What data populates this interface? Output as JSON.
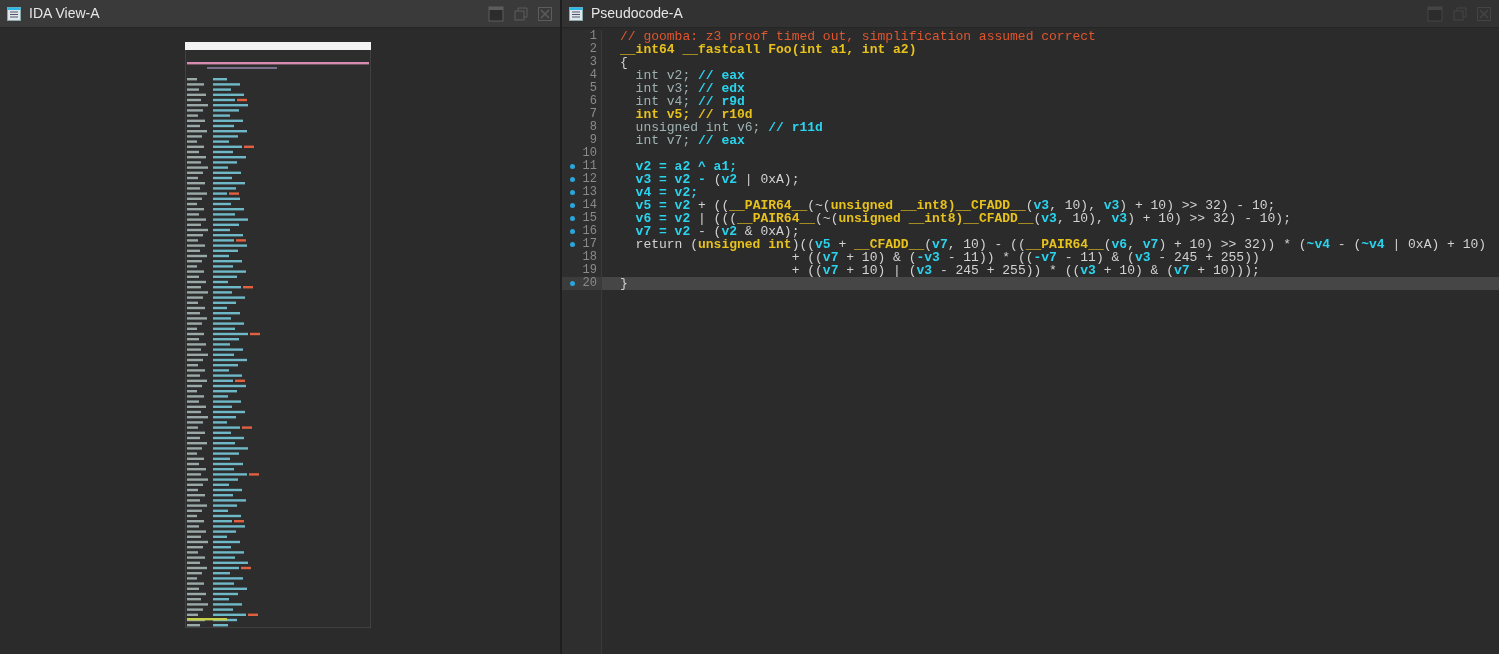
{
  "left_panel": {
    "title": "IDA View-A"
  },
  "right_panel": {
    "title": "Pseudocode-A",
    "lines": [
      {
        "number": "1",
        "breakpoint": false,
        "selected": false,
        "tokens": [
          {
            "kind": "comment",
            "text": "// goomba: z3 proof timed out, simplification assumed correct"
          }
        ]
      },
      {
        "number": "2",
        "breakpoint": false,
        "selected": false,
        "tokens": [
          {
            "kind": "type",
            "text": "__int64 __fastcall Foo(int a1, int a2)"
          }
        ]
      },
      {
        "number": "3",
        "breakpoint": false,
        "selected": false,
        "tokens": [
          {
            "kind": "code",
            "text": "{"
          }
        ]
      },
      {
        "number": "4",
        "breakpoint": false,
        "selected": false,
        "tokens": [
          {
            "kind": "dim",
            "text": "  int v2; "
          },
          {
            "kind": "var",
            "text": "// eax"
          }
        ]
      },
      {
        "number": "5",
        "breakpoint": false,
        "selected": false,
        "tokens": [
          {
            "kind": "dim",
            "text": "  int v3; "
          },
          {
            "kind": "var",
            "text": "// edx"
          }
        ]
      },
      {
        "number": "6",
        "breakpoint": false,
        "selected": false,
        "tokens": [
          {
            "kind": "dim",
            "text": "  int v4; "
          },
          {
            "kind": "var",
            "text": "// r9d"
          }
        ]
      },
      {
        "number": "7",
        "breakpoint": false,
        "selected": false,
        "tokens": [
          {
            "kind": "type",
            "text": "  int v5; // r10d"
          }
        ]
      },
      {
        "number": "8",
        "breakpoint": false,
        "selected": false,
        "tokens": [
          {
            "kind": "dim",
            "text": "  unsigned int v6; "
          },
          {
            "kind": "var",
            "text": "// r11d"
          }
        ]
      },
      {
        "number": "9",
        "breakpoint": false,
        "selected": false,
        "tokens": [
          {
            "kind": "dim",
            "text": "  int v7; "
          },
          {
            "kind": "var",
            "text": "// eax"
          }
        ]
      },
      {
        "number": "10",
        "breakpoint": false,
        "selected": false
      },
      {
        "number": "11",
        "breakpoint": true,
        "selected": false,
        "tokens": [
          {
            "kind": "var",
            "text": "  v2 = a2 ^ a1;"
          }
        ]
      },
      {
        "number": "12",
        "breakpoint": true,
        "selected": false,
        "tokens": [
          {
            "kind": "var",
            "text": "  v3 = v2 - "
          },
          {
            "kind": "code",
            "text": "("
          },
          {
            "kind": "var",
            "text": "v2"
          },
          {
            "kind": "code",
            "text": " | 0xA);"
          }
        ]
      },
      {
        "number": "13",
        "breakpoint": true,
        "selected": false,
        "tokens": [
          {
            "kind": "var",
            "text": "  v4 = v2;"
          }
        ]
      },
      {
        "number": "14",
        "breakpoint": true,
        "selected": false,
        "tokens": [
          {
            "kind": "var",
            "text": "  v5 = v2 "
          },
          {
            "kind": "code",
            "text": "+ (("
          },
          {
            "kind": "type",
            "text": "__PAIR64__"
          },
          {
            "kind": "code",
            "text": "(~("
          },
          {
            "kind": "type",
            "text": "unsigned __int8)__CFADD__"
          },
          {
            "kind": "code",
            "text": "("
          },
          {
            "kind": "var",
            "text": "v3"
          },
          {
            "kind": "code",
            "text": ", 10), "
          },
          {
            "kind": "var",
            "text": "v3"
          },
          {
            "kind": "code",
            "text": ") + 10) >> 32) - 10;"
          }
        ]
      },
      {
        "number": "15",
        "breakpoint": true,
        "selected": false,
        "tokens": [
          {
            "kind": "var",
            "text": "  v6 = v2 "
          },
          {
            "kind": "code",
            "text": "| ((("
          },
          {
            "kind": "type",
            "text": "__PAIR64__"
          },
          {
            "kind": "code",
            "text": "(~("
          },
          {
            "kind": "type",
            "text": "unsigned __int8)__CFADD__"
          },
          {
            "kind": "code",
            "text": "("
          },
          {
            "kind": "var",
            "text": "v3"
          },
          {
            "kind": "code",
            "text": ", 10), "
          },
          {
            "kind": "var",
            "text": "v3"
          },
          {
            "kind": "code",
            "text": ") + 10) >> 32) - 10);"
          }
        ]
      },
      {
        "number": "16",
        "breakpoint": true,
        "selected": false,
        "tokens": [
          {
            "kind": "var",
            "text": "  v7 = v2 "
          },
          {
            "kind": "code",
            "text": "- ("
          },
          {
            "kind": "var",
            "text": "v2"
          },
          {
            "kind": "code",
            "text": " & 0xA);"
          }
        ]
      },
      {
        "number": "17",
        "breakpoint": true,
        "selected": false,
        "tokens": [
          {
            "kind": "code",
            "text": "  return ("
          },
          {
            "kind": "type",
            "text": "unsigned int"
          },
          {
            "kind": "code",
            "text": ")(("
          },
          {
            "kind": "var",
            "text": "v5"
          },
          {
            "kind": "code",
            "text": " + "
          },
          {
            "kind": "type",
            "text": "__CFADD__"
          },
          {
            "kind": "code",
            "text": "("
          },
          {
            "kind": "var",
            "text": "v7"
          },
          {
            "kind": "code",
            "text": ", 10) - (("
          },
          {
            "kind": "type",
            "text": "__PAIR64__"
          },
          {
            "kind": "code",
            "text": "("
          },
          {
            "kind": "var",
            "text": "v6"
          },
          {
            "kind": "code",
            "text": ", "
          },
          {
            "kind": "var",
            "text": "v7"
          },
          {
            "kind": "code",
            "text": ") + 10) >> 32)) * ("
          },
          {
            "kind": "var",
            "text": "~v4"
          },
          {
            "kind": "code",
            "text": " - ("
          },
          {
            "kind": "var",
            "text": "~v4"
          },
          {
            "kind": "code",
            "text": " | 0xA) + 10)"
          }
        ]
      },
      {
        "number": "18",
        "breakpoint": false,
        "selected": false,
        "tokens": [
          {
            "kind": "code",
            "text": "                      + (("
          },
          {
            "kind": "var",
            "text": "v7"
          },
          {
            "kind": "code",
            "text": " + 10) & ("
          },
          {
            "kind": "var",
            "text": "-v3"
          },
          {
            "kind": "code",
            "text": " - 11)) * (("
          },
          {
            "kind": "var",
            "text": "-v7"
          },
          {
            "kind": "code",
            "text": " - 11) & ("
          },
          {
            "kind": "var",
            "text": "v3"
          },
          {
            "kind": "code",
            "text": " - 245 + 255))"
          }
        ]
      },
      {
        "number": "19",
        "breakpoint": false,
        "selected": false,
        "tokens": [
          {
            "kind": "code",
            "text": "                      + (("
          },
          {
            "kind": "var",
            "text": "v7"
          },
          {
            "kind": "code",
            "text": " + 10) | ("
          },
          {
            "kind": "var",
            "text": "v3"
          },
          {
            "kind": "code",
            "text": " - 245 + 255)) * (("
          },
          {
            "kind": "var",
            "text": "v3"
          },
          {
            "kind": "code",
            "text": " + 10) & ("
          },
          {
            "kind": "var",
            "text": "v7"
          },
          {
            "kind": "code",
            "text": " + 10)));"
          }
        ]
      },
      {
        "number": "20",
        "breakpoint": true,
        "selected": true,
        "tokens": [
          {
            "kind": "code",
            "text": "}"
          }
        ]
      }
    ]
  }
}
